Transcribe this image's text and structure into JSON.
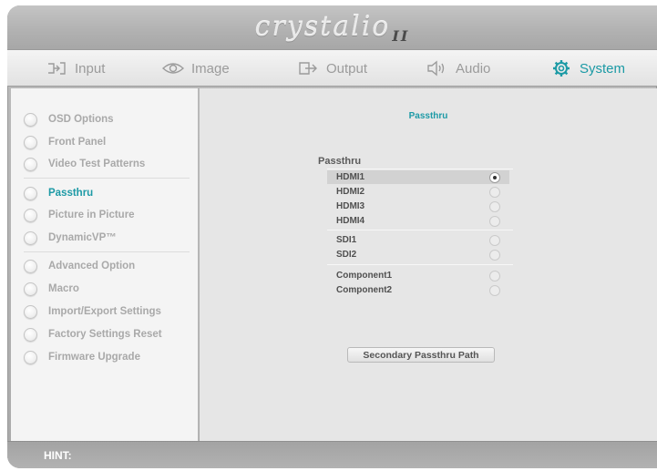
{
  "brand": {
    "name": "crystalio",
    "mark": "II"
  },
  "tabs": [
    {
      "label": "Input",
      "icon": "input-icon"
    },
    {
      "label": "Image",
      "icon": "eye-icon"
    },
    {
      "label": "Output",
      "icon": "output-icon"
    },
    {
      "label": "Audio",
      "icon": "speaker-icon"
    },
    {
      "label": "System",
      "icon": "gear-icon",
      "active": true
    }
  ],
  "sidebar": {
    "items": [
      {
        "label": "OSD Options"
      },
      {
        "label": "Front Panel"
      },
      {
        "label": "Video Test Patterns"
      },
      {
        "label": "Passthru",
        "active": true
      },
      {
        "label": "Picture in Picture"
      },
      {
        "label": "DynamicVP™"
      },
      {
        "label": "Advanced Option"
      },
      {
        "label": "Macro"
      },
      {
        "label": "Import/Export Settings"
      },
      {
        "label": "Factory Settings Reset"
      },
      {
        "label": "Firmware Upgrade"
      }
    ]
  },
  "content": {
    "title": "Passthru",
    "group_label": "Passthru",
    "options": [
      {
        "label": "HDMI1",
        "selected": true
      },
      {
        "label": "HDMI2"
      },
      {
        "label": "HDMI3"
      },
      {
        "label": "HDMI4"
      },
      {
        "label": "SDI1"
      },
      {
        "label": "SDI2"
      },
      {
        "label": "Component1"
      },
      {
        "label": "Component2"
      }
    ],
    "secondary_button": "Secondary Passthru Path"
  },
  "hint": {
    "label": "HINT:"
  },
  "colors": {
    "accent": "#1d9aa6"
  }
}
